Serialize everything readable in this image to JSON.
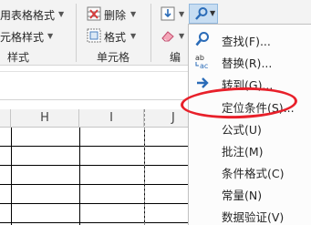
{
  "ribbon": {
    "styles": {
      "format_as_table": "用表格格式",
      "cell_styles": "元格样式"
    },
    "styles_group_label": "样式",
    "cells": {
      "delete": "删除",
      "format": "格式"
    },
    "cells_group_label": "单元格",
    "editing_group_label": "编"
  },
  "columns": [
    {
      "label": ""
    },
    {
      "label": "H"
    },
    {
      "label": "I"
    },
    {
      "label": "J"
    }
  ],
  "menu": {
    "items": [
      {
        "label": "查找(F)...",
        "icon": "search-icon"
      },
      {
        "label": "替换(R)...",
        "icon": "replace-icon"
      },
      {
        "label": "转到(G)...",
        "icon": "arrow-right-icon"
      },
      {
        "label": "定位条件(S)...",
        "icon": "none",
        "highlighted": true
      },
      {
        "label": "公式(U)",
        "icon": "none"
      },
      {
        "label": "批注(M)",
        "icon": "none"
      },
      {
        "label": "条件格式(C)",
        "icon": "none"
      },
      {
        "label": "常量(N)",
        "icon": "none"
      },
      {
        "label": "数据验证(V)",
        "icon": "none"
      }
    ]
  },
  "colors": {
    "highlight_ring": "#e8202a",
    "accent_blue": "#2b6cb8",
    "selected_button": "#c7ddf2"
  }
}
